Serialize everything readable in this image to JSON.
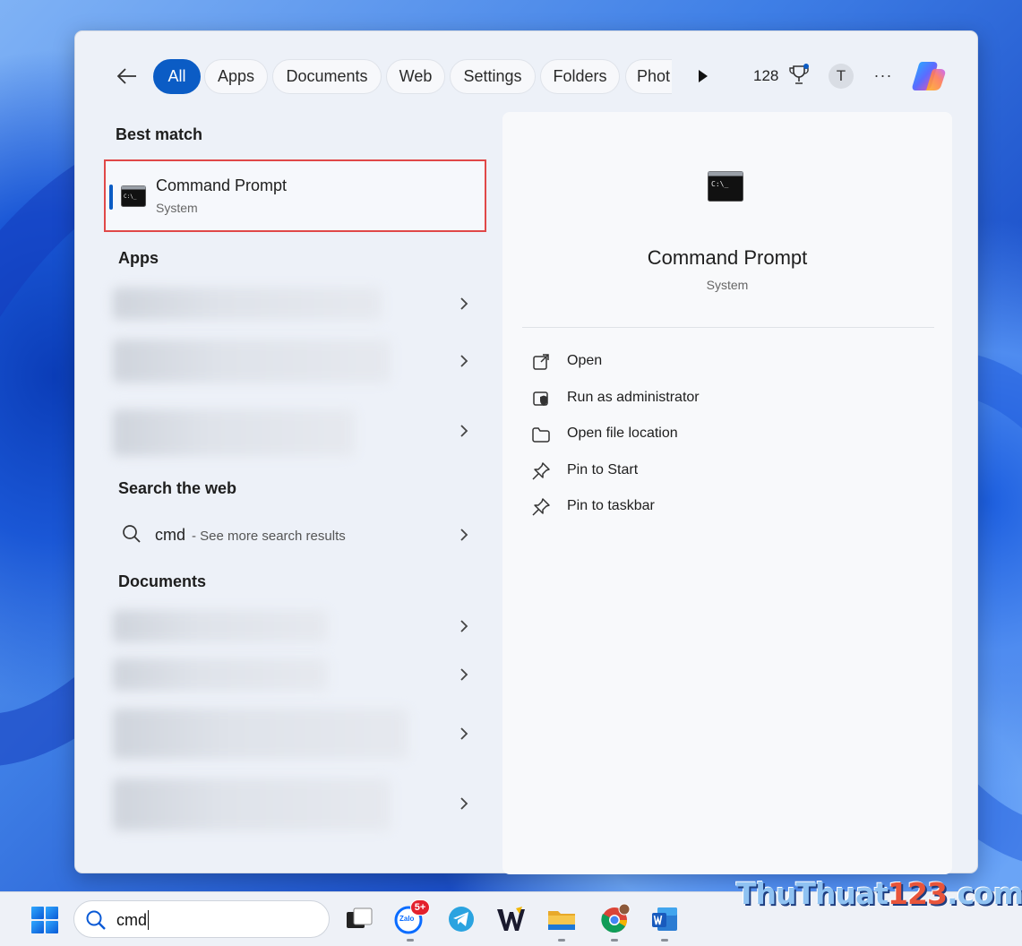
{
  "search_panel": {
    "filters": [
      {
        "label": "All",
        "active": true
      },
      {
        "label": "Apps",
        "active": false
      },
      {
        "label": "Documents",
        "active": false
      },
      {
        "label": "Web",
        "active": false
      },
      {
        "label": "Settings",
        "active": false
      },
      {
        "label": "Folders",
        "active": false
      },
      {
        "label": "Phot",
        "active": false
      }
    ],
    "points": "128",
    "avatar_initial": "T",
    "more_label": "···"
  },
  "results": {
    "best_match_heading": "Best match",
    "best_match": {
      "name": "Command Prompt",
      "type": "System",
      "icon": "cmd-icon"
    },
    "apps_heading": "Apps",
    "search_web_heading": "Search the web",
    "web_result": {
      "query": "cmd",
      "suffix": "- See more search results"
    },
    "documents_heading": "Documents"
  },
  "detail": {
    "name": "Command Prompt",
    "type": "System",
    "actions": [
      {
        "label": "Open",
        "icon": "open-external-icon"
      },
      {
        "label": "Run as administrator",
        "icon": "shield-admin-icon"
      },
      {
        "label": "Open file location",
        "icon": "folder-icon"
      },
      {
        "label": "Pin to Start",
        "icon": "pin-icon"
      },
      {
        "label": "Pin to taskbar",
        "icon": "pin-icon"
      }
    ]
  },
  "taskbar": {
    "search_value": "cmd",
    "zalo_badge": "5+",
    "zalo_label": "Zalo",
    "apps": [
      "task-view",
      "zalo",
      "telegram",
      "winrar",
      "file-explorer",
      "chrome",
      "word"
    ]
  },
  "watermark": {
    "text": "ThuThuat",
    "num": "123",
    "suffix": ".com"
  },
  "colors": {
    "accent": "#0b5cc5",
    "highlight_border": "#e04848"
  }
}
